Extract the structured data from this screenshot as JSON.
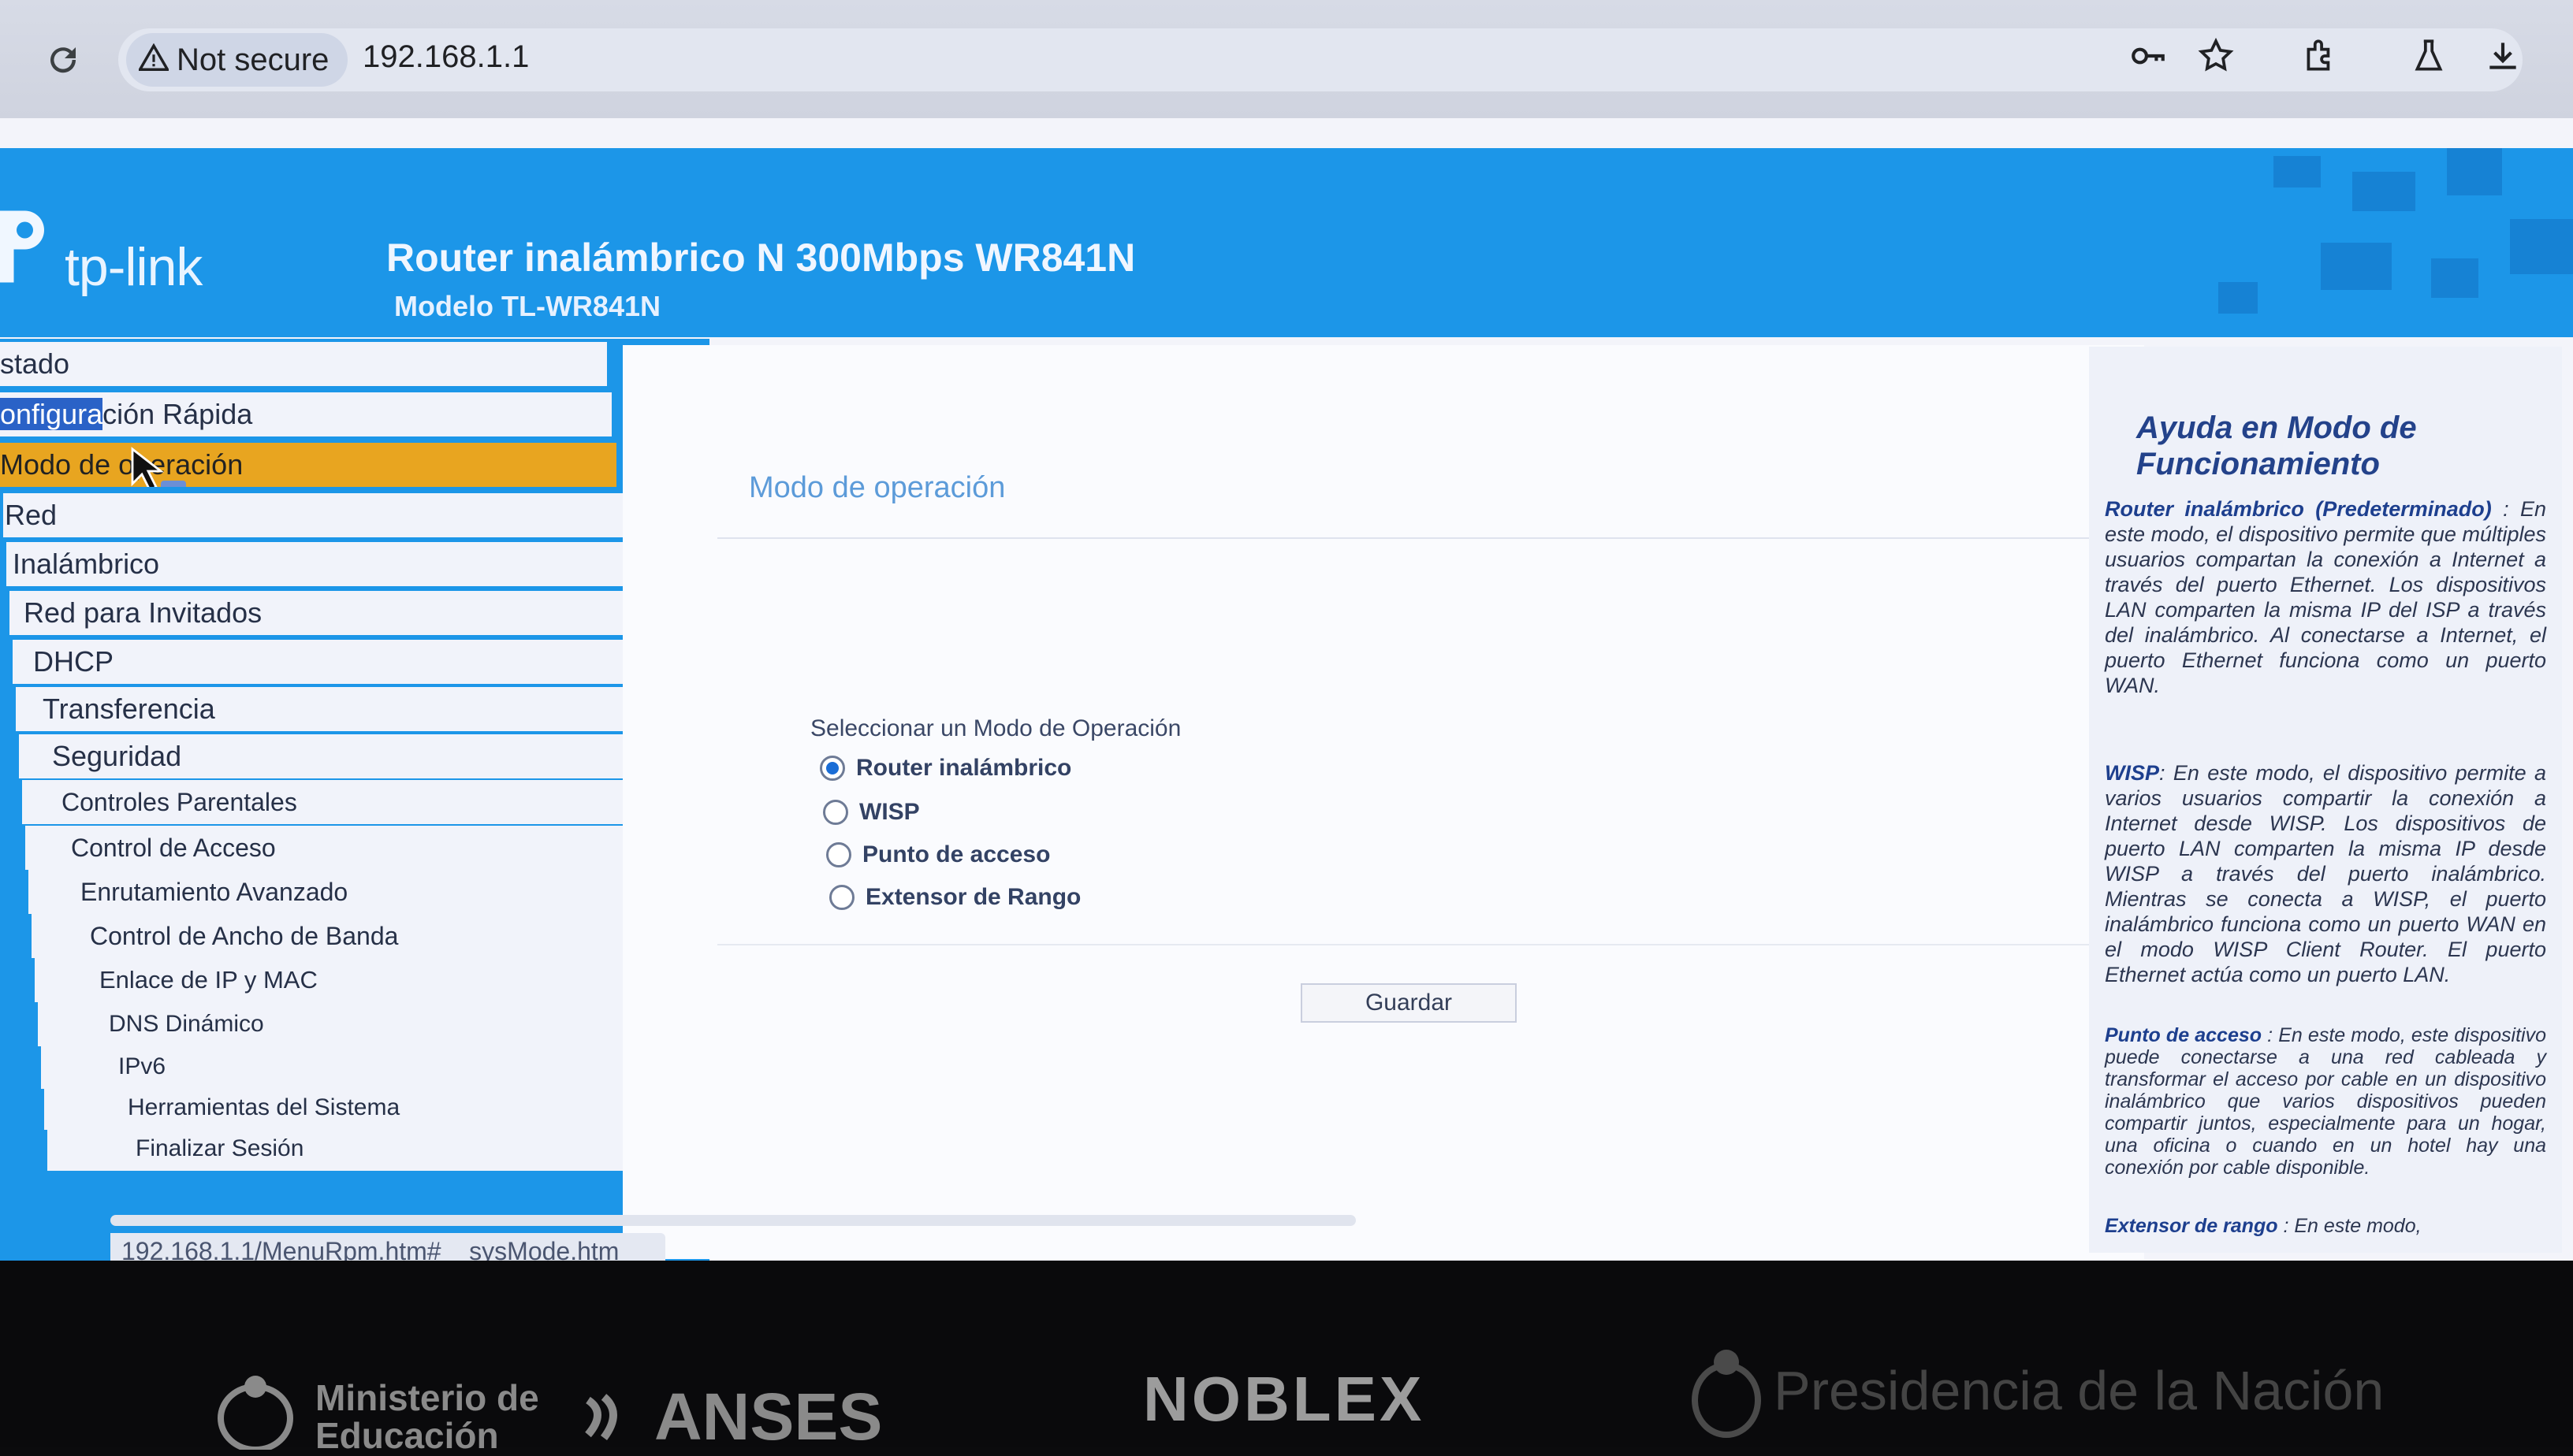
{
  "browser": {
    "security_label": "Not secure",
    "url": "192.168.1.1"
  },
  "header": {
    "logo_text": "tp-link",
    "title": "Router inalámbrico N 300Mbps WR841N",
    "model": "Modelo TL-WR841N"
  },
  "sidebar": {
    "items": [
      {
        "label": "stado"
      },
      {
        "label_hl": "onfigura",
        "label": "ción Rápida"
      },
      {
        "label": "Modo de operación"
      },
      {
        "label": "Red"
      },
      {
        "label": "Inalámbrico"
      },
      {
        "label": "Red para Invitados"
      },
      {
        "label": "DHCP"
      },
      {
        "label": "Transferencia"
      },
      {
        "label": "Seguridad"
      },
      {
        "label": "Controles Parentales"
      },
      {
        "label": "Control de Acceso"
      },
      {
        "label": "Enrutamiento Avanzado"
      },
      {
        "label": "Control de Ancho de Banda"
      },
      {
        "label": "Enlace de IP y MAC"
      },
      {
        "label": "DNS Dinámico"
      },
      {
        "label": "IPv6"
      },
      {
        "label": "Herramientas del Sistema"
      },
      {
        "label": "Finalizar Sesión"
      }
    ],
    "status_url": "192.168.1.1/MenuRpm.htm#__sysMode.htm"
  },
  "main": {
    "section_title": "Modo de operación",
    "select_label": "Seleccionar un Modo de Operación",
    "options": [
      {
        "label": "Router inalámbrico",
        "selected": true
      },
      {
        "label": "WISP",
        "selected": false
      },
      {
        "label": "Punto de acceso",
        "selected": false
      },
      {
        "label": "Extensor de Rango",
        "selected": false
      }
    ],
    "save_label": "Guardar"
  },
  "help": {
    "title": "Ayuda en Modo de Funcionamiento",
    "p1_head": "Router inalámbrico (Predeterminado)",
    "p1_body": ": En este modo, el dispositivo permite que múltiples usuarios compartan la conexión a Internet a través del puerto Ethernet. Los dispositivos LAN comparten la misma IP del ISP a través del inalámbrico. Al conectarse a Internet, el puerto Ethernet funciona como un puerto WAN.",
    "p2_head": "WISP",
    "p2_body": ": En este modo, el dispositivo permite a varios usuarios compartir la conexión a Internet desde WISP. Los dispositivos de puerto LAN comparten la misma IP desde WISP a través del puerto inalámbrico. Mientras se conecta a WISP, el puerto inalámbrico funciona como un puerto WAN en el modo WISP Client Router. El puerto Ethernet actúa como un puerto LAN.",
    "p3_head": "Punto de acceso",
    "p3_body": ": En este modo, este dispositivo puede conectarse a una red cableada y transformar el acceso por cable en un dispositivo inalámbrico que varios dispositivos pueden compartir juntos, especialmente para un hogar, una oficina o cuando en un hotel hay una conexión por cable disponible.",
    "p4_head": "Extensor de rango",
    "p4_body": ": En este modo,"
  },
  "bezel": {
    "ministerio": "Ministerio de Educación",
    "anses": "ANSES",
    "brand": "NOBLEX",
    "presidencia": "Presidencia de la Nación"
  },
  "colors": {
    "tplink_blue": "#1c96e8",
    "menu_active": "#e8a520",
    "link_blue": "#5c9bd9"
  },
  "icons": [
    "reload-icon",
    "warning-icon",
    "key-icon",
    "star-icon",
    "extensions-icon",
    "labs-icon",
    "download-icon",
    "mouse-cursor-icon"
  ]
}
